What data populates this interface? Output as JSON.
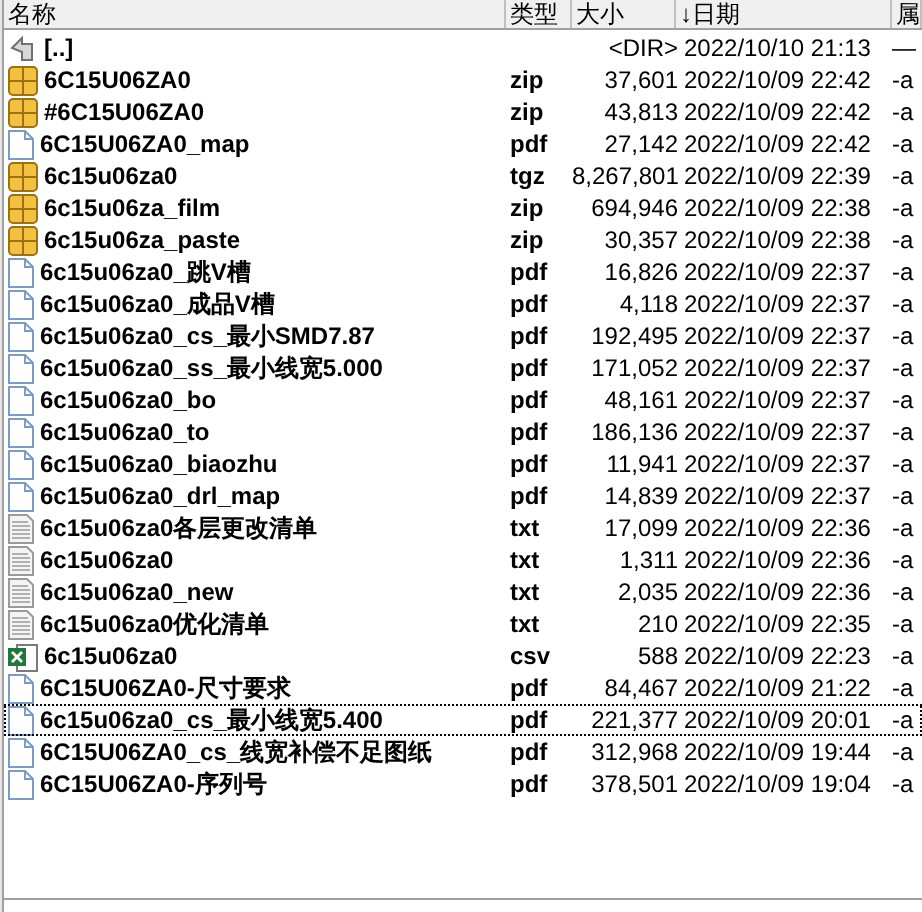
{
  "columns": [
    {
      "label": "名称"
    },
    {
      "label": "类型"
    },
    {
      "label": "大小"
    },
    {
      "label": "↓日期"
    },
    {
      "label": "属"
    }
  ],
  "rows": [
    {
      "kind": "up",
      "name": "[..]",
      "type": "",
      "size": "<DIR>",
      "date": "2022/10/10 21:13",
      "attr": "—",
      "focused": false
    },
    {
      "kind": "zip",
      "name": "6C15U06ZA0",
      "type": "zip",
      "size": "37,601",
      "date": "2022/10/09 22:42",
      "attr": "-a",
      "focused": false
    },
    {
      "kind": "zip",
      "name": "#6C15U06ZA0",
      "type": "zip",
      "size": "43,813",
      "date": "2022/10/09 22:42",
      "attr": "-a",
      "focused": false
    },
    {
      "kind": "doc",
      "name": "6C15U06ZA0_map",
      "type": "pdf",
      "size": "27,142",
      "date": "2022/10/09 22:42",
      "attr": "-a",
      "focused": false
    },
    {
      "kind": "zip",
      "name": "6c15u06za0",
      "type": "tgz",
      "size": "8,267,801",
      "date": "2022/10/09 22:39",
      "attr": "-a",
      "focused": false
    },
    {
      "kind": "zip",
      "name": "6c15u06za_film",
      "type": "zip",
      "size": "694,946",
      "date": "2022/10/09 22:38",
      "attr": "-a",
      "focused": false
    },
    {
      "kind": "zip",
      "name": "6c15u06za_paste",
      "type": "zip",
      "size": "30,357",
      "date": "2022/10/09 22:38",
      "attr": "-a",
      "focused": false
    },
    {
      "kind": "doc",
      "name": "6c15u06za0_跳V槽",
      "type": "pdf",
      "size": "16,826",
      "date": "2022/10/09 22:37",
      "attr": "-a",
      "focused": false
    },
    {
      "kind": "doc",
      "name": "6c15u06za0_成品V槽",
      "type": "pdf",
      "size": "4,118",
      "date": "2022/10/09 22:37",
      "attr": "-a",
      "focused": false
    },
    {
      "kind": "doc",
      "name": "6c15u06za0_cs_最小SMD7.87",
      "type": "pdf",
      "size": "192,495",
      "date": "2022/10/09 22:37",
      "attr": "-a",
      "focused": false
    },
    {
      "kind": "doc",
      "name": "6c15u06za0_ss_最小线宽5.000",
      "type": "pdf",
      "size": "171,052",
      "date": "2022/10/09 22:37",
      "attr": "-a",
      "focused": false
    },
    {
      "kind": "doc",
      "name": "6c15u06za0_bo",
      "type": "pdf",
      "size": "48,161",
      "date": "2022/10/09 22:37",
      "attr": "-a",
      "focused": false
    },
    {
      "kind": "doc",
      "name": "6c15u06za0_to",
      "type": "pdf",
      "size": "186,136",
      "date": "2022/10/09 22:37",
      "attr": "-a",
      "focused": false
    },
    {
      "kind": "doc",
      "name": "6c15u06za0_biaozhu",
      "type": "pdf",
      "size": "11,941",
      "date": "2022/10/09 22:37",
      "attr": "-a",
      "focused": false
    },
    {
      "kind": "doc",
      "name": "6c15u06za0_drl_map",
      "type": "pdf",
      "size": "14,839",
      "date": "2022/10/09 22:37",
      "attr": "-a",
      "focused": false
    },
    {
      "kind": "text",
      "name": "6c15u06za0各层更改清单",
      "type": "txt",
      "size": "17,099",
      "date": "2022/10/09 22:36",
      "attr": "-a",
      "focused": false
    },
    {
      "kind": "text",
      "name": "6c15u06za0",
      "type": "txt",
      "size": "1,311",
      "date": "2022/10/09 22:36",
      "attr": "-a",
      "focused": false
    },
    {
      "kind": "text",
      "name": "6c15u06za0_new",
      "type": "txt",
      "size": "2,035",
      "date": "2022/10/09 22:36",
      "attr": "-a",
      "focused": false
    },
    {
      "kind": "text",
      "name": "6c15u06za0优化清单",
      "type": "txt",
      "size": "210",
      "date": "2022/10/09 22:35",
      "attr": "-a",
      "focused": false
    },
    {
      "kind": "sheet",
      "name": "6c15u06za0",
      "type": "csv",
      "size": "588",
      "date": "2022/10/09 22:23",
      "attr": "-a",
      "focused": false
    },
    {
      "kind": "doc",
      "name": "6C15U06ZA0-尺寸要求",
      "type": "pdf",
      "size": "84,467",
      "date": "2022/10/09 21:22",
      "attr": "-a",
      "focused": false
    },
    {
      "kind": "doc",
      "name": "6c15u06za0_cs_最小线宽5.400",
      "type": "pdf",
      "size": "221,377",
      "date": "2022/10/09 20:01",
      "attr": "-a",
      "focused": true
    },
    {
      "kind": "doc",
      "name": "6C15U06ZA0_cs_线宽补偿不足图纸",
      "type": "pdf",
      "size": "312,968",
      "date": "2022/10/09 19:44",
      "attr": "-a",
      "focused": false
    },
    {
      "kind": "doc",
      "name": "6C15U06ZA0-序列号",
      "type": "pdf",
      "size": "378,501",
      "date": "2022/10/09 19:04",
      "attr": "-a",
      "focused": false
    }
  ]
}
